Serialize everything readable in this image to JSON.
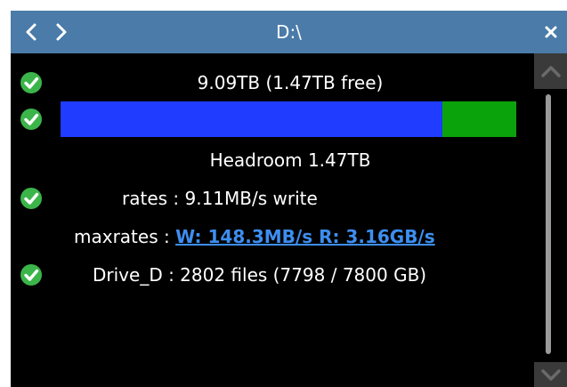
{
  "window": {
    "title": "D:\\",
    "back_icon": "chevron-left-icon",
    "forward_icon": "chevron-right-icon",
    "close_icon": "close-icon"
  },
  "colors": {
    "titlebar": "#4a7ba9",
    "background": "#000000",
    "bar_used": "#1f3cff",
    "bar_free": "#0ba30b",
    "link": "#3d8ef0",
    "check": "#3bb54a"
  },
  "drive": {
    "capacity_text": "9.09TB (1.47TB free)",
    "used_fraction": 0.838,
    "headroom_text": "Headroom 1.47TB",
    "rates_text": "rates : 9.11MB/s write",
    "maxrates_label": "maxrates : ",
    "maxrates_link": "W: 148.3MB/s R: 3.16GB/s",
    "files_text": "Drive_D : 2802 files (7798 / 7800 GB)"
  }
}
